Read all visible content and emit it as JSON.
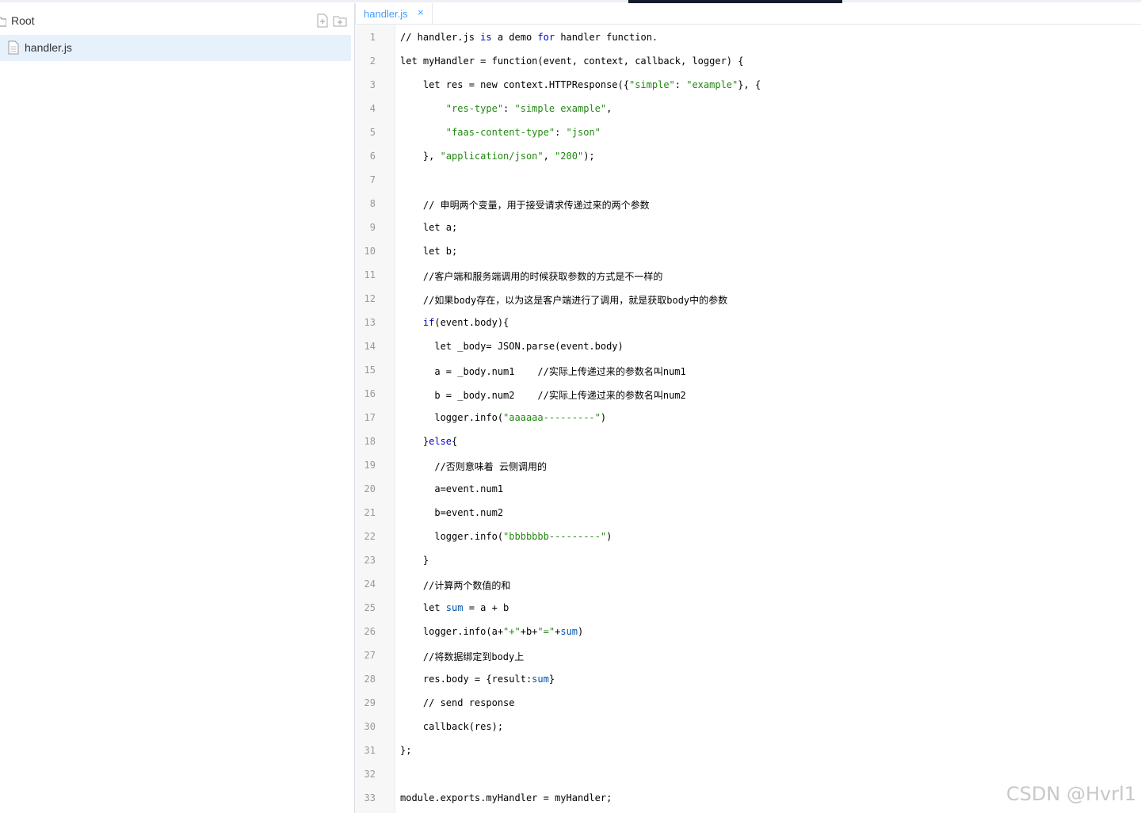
{
  "sidebar": {
    "root_label": "Root",
    "items": [
      {
        "label": "handler.js"
      }
    ]
  },
  "editor": {
    "tab": {
      "label": "handler.js",
      "close": "×"
    },
    "lines": [
      {
        "num": "1",
        "text": "// handler.js is a demo for handler function."
      },
      {
        "num": "2",
        "text": "let myHandler = function(event, context, callback, logger) {"
      },
      {
        "num": "3",
        "text": "    let res = new context.HTTPResponse({\"simple\": \"example\"}, {"
      },
      {
        "num": "4",
        "text": "        \"res-type\": \"simple example\","
      },
      {
        "num": "5",
        "text": "        \"faas-content-type\": \"json\""
      },
      {
        "num": "6",
        "text": "    }, \"application/json\", \"200\");"
      },
      {
        "num": "7",
        "text": ""
      },
      {
        "num": "8",
        "text": "    // 申明两个变量，用于接受请求传递过来的两个参数"
      },
      {
        "num": "9",
        "text": "    let a;"
      },
      {
        "num": "10",
        "text": "    let b;"
      },
      {
        "num": "11",
        "text": "    //客户端和服务端调用的时候获取参数的方式是不一样的"
      },
      {
        "num": "12",
        "text": "    //如果body存在，以为这是客户端进行了调用，就是获取body中的参数"
      },
      {
        "num": "13",
        "text": "    if(event.body){"
      },
      {
        "num": "14",
        "text": "      let _body= JSON.parse(event.body)"
      },
      {
        "num": "15",
        "text": "      a = _body.num1    //实际上传递过来的参数名叫num1"
      },
      {
        "num": "16",
        "text": "      b = _body.num2    //实际上传递过来的参数名叫num2"
      },
      {
        "num": "17",
        "text": "      logger.info(\"aaaaaa---------\")"
      },
      {
        "num": "18",
        "text": "    }else{"
      },
      {
        "num": "19",
        "text": "      //否则意味着 云侧调用的"
      },
      {
        "num": "20",
        "text": "      a=event.num1"
      },
      {
        "num": "21",
        "text": "      b=event.num2"
      },
      {
        "num": "22",
        "text": "      logger.info(\"bbbbbbb---------\")"
      },
      {
        "num": "23",
        "text": "    }"
      },
      {
        "num": "24",
        "text": "    //计算两个数值的和"
      },
      {
        "num": "25",
        "text": "    let sum = a + b"
      },
      {
        "num": "26",
        "text": "    logger.info(a+\"+\"+b+\"=\"+sum)"
      },
      {
        "num": "27",
        "text": "    //将数据绑定到body上"
      },
      {
        "num": "28",
        "text": "    res.body = {result:sum}"
      },
      {
        "num": "29",
        "text": "    // send response"
      },
      {
        "num": "30",
        "text": "    callback(res);"
      },
      {
        "num": "31",
        "text": "};"
      },
      {
        "num": "32",
        "text": ""
      },
      {
        "num": "33",
        "text": "module.exports.myHandler = myHandler;"
      }
    ]
  },
  "watermark": "CSDN @Hvrl1",
  "colors": {
    "accent": "#409eff",
    "selected_bg": "#e6f1fc",
    "keyword": "#770088",
    "string": "#228811"
  }
}
